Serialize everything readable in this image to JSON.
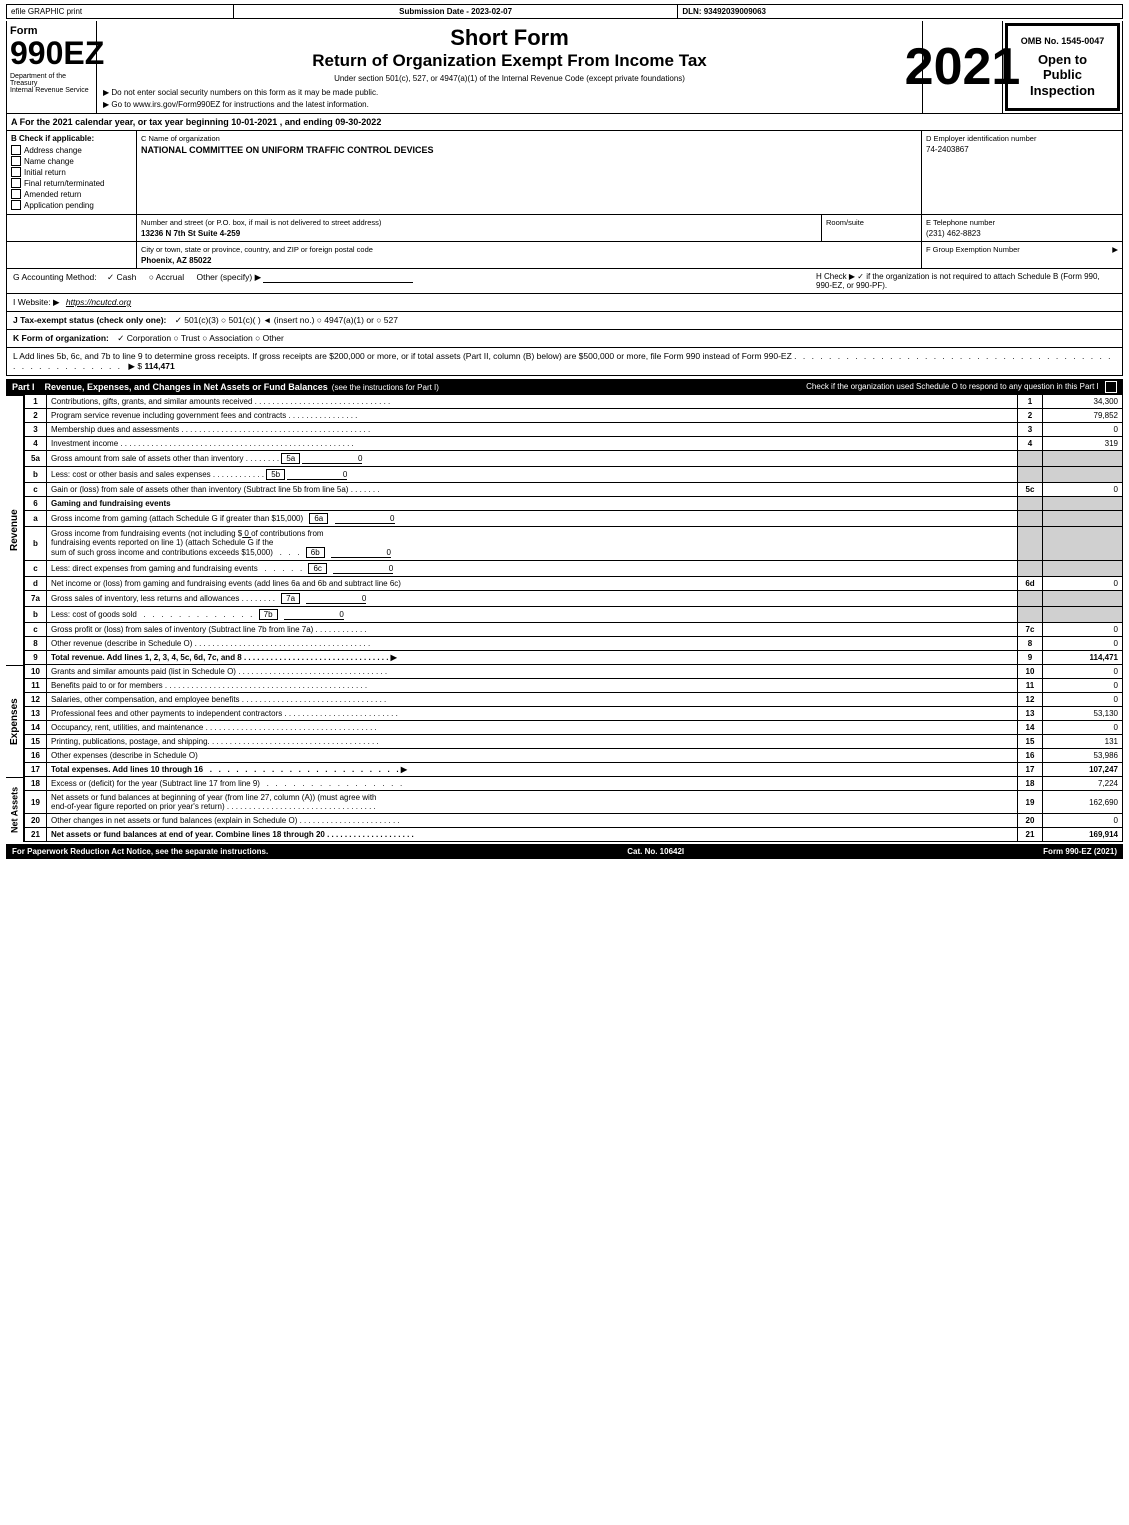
{
  "header": {
    "efile_label": "efile GRAPHIC print",
    "submission_label": "Submission Date - 2023-02-07",
    "dln_label": "DLN: 93492039009063"
  },
  "form": {
    "number": "990EZ",
    "short_form": "Short Form",
    "return_title": "Return of Organization Exempt From Income Tax",
    "subtitle": "Under section 501(c), 527, or 4947(a)(1) of the Internal Revenue Code (except private foundations)",
    "ssn_notice": "▶ Do not enter social security numbers on this form as it may be made public.",
    "goto_notice": "▶ Go to www.irs.gov/Form990EZ for instructions and the latest information.",
    "year": "2021",
    "omb": "OMB No. 1545-0047",
    "open_to_public": "Open to Public Inspection"
  },
  "dept": {
    "name": "Department of the Treasury",
    "sub": "Internal Revenue Service"
  },
  "section_a": {
    "text": "A  For the 2021 calendar year, or tax year beginning 10-01-2021 , and ending 09-30-2022"
  },
  "check_applicable": {
    "label": "B  Check if applicable:",
    "items": [
      {
        "label": "Address change",
        "checked": false
      },
      {
        "label": "Name change",
        "checked": false
      },
      {
        "label": "Initial return",
        "checked": false
      },
      {
        "label": "Final return/terminated",
        "checked": false
      },
      {
        "label": "Amended return",
        "checked": false
      },
      {
        "label": "Application pending",
        "checked": false
      }
    ]
  },
  "org": {
    "name_label": "C Name of organization",
    "name": "NATIONAL COMMITTEE ON UNIFORM TRAFFIC CONTROL DEVICES",
    "address_label": "Number and street (or P.O. box, if mail is not delivered to street address)",
    "address": "13236 N 7th St Suite 4-259",
    "room_label": "Room/suite",
    "room": "",
    "city_label": "City or town, state or province, country, and ZIP or foreign postal code",
    "city": "Phoenix, AZ  85022",
    "ein_label": "D Employer identification number",
    "ein": "74-2403867",
    "phone_label": "E Telephone number",
    "phone": "(231) 462-8823",
    "group_label": "F Group Exemption Number",
    "group_num": "▶"
  },
  "accounting": {
    "label": "G Accounting Method:",
    "cash": "✓ Cash",
    "accrual": "○ Accrual",
    "other": "Other (specify) ▶",
    "check_h": "H  Check ▶  ✓ if the organization is not required to attach Schedule B (Form 990, 990-EZ, or 990-PF)."
  },
  "website": {
    "label": "I Website: ▶",
    "url": "https://ncutcd.org"
  },
  "tax_exempt": {
    "label": "J Tax-exempt status (check only one):",
    "options": "✓ 501(c)(3)  ○ 501(c)(  )  ◄ (insert no.)  ○ 4947(a)(1) or  ○ 527"
  },
  "form_org": {
    "label": "K Form of organization:",
    "options": "✓ Corporation   ○ Trust   ○ Association   ○ Other"
  },
  "add_lines": {
    "text": "L Add lines 5b, 6c, and 7b to line 9 to determine gross receipts. If gross receipts are $200,000 or more, or if total assets (Part II, column (B) below) are $500,000 or more, file Form 990 instead of Form 990-EZ",
    "dots": ". . . . . . . . . . . . . . . . . . . . . . . . . . . . . . . . . . . . . . . . . . . . . . . . . .",
    "arrow": "▶ $",
    "value": "114,471"
  },
  "part1": {
    "label": "Part I",
    "title": "Revenue, Expenses, and Changes in Net Assets or Fund Balances",
    "subtitle": "(see the instructions for Part I)",
    "check_schedule_o": "Check if the organization used Schedule O to respond to any question in this Part I",
    "rows": [
      {
        "num": "1",
        "desc": "Contributions, gifts, grants, and similar amounts received",
        "dots": true,
        "line_col": "1",
        "value": "34,300"
      },
      {
        "num": "2",
        "desc": "Program service revenue including government fees and contracts",
        "dots": true,
        "line_col": "2",
        "value": "79,852"
      },
      {
        "num": "3",
        "desc": "Membership dues and assessments",
        "dots": true,
        "line_col": "3",
        "value": "0"
      },
      {
        "num": "4",
        "desc": "Investment income",
        "dots": true,
        "line_col": "4",
        "value": "319"
      },
      {
        "num": "5a",
        "desc": "Gross amount from sale of assets other than inventory",
        "dots": true,
        "sub_label": "5a",
        "sub_value": "0"
      },
      {
        "num": "5b",
        "desc": "Less: cost or other basis and sales expenses",
        "dots": true,
        "sub_label": "5b",
        "sub_value": "0"
      },
      {
        "num": "5c",
        "desc": "Gain or (loss) from sale of assets other than inventory (Subtract line 5b from line 5a)",
        "dots": true,
        "line_col": "5c",
        "value": "0"
      },
      {
        "num": "6",
        "desc": "Gaming and fundraising events",
        "dots": false
      },
      {
        "num": "6a",
        "desc": "Gross income from gaming (attach Schedule G if greater than $15,000)",
        "sub_label": "6a",
        "sub_value": "0",
        "dots": false
      },
      {
        "num": "6b",
        "desc": "Gross income from fundraising events (not including $ 0 of contributions from fundraising events reported on line 1) (attach Schedule G if the sum of such gross income and contributions exceeds $15,000)",
        "sub_label": "6b",
        "sub_value": "0",
        "dots": false
      },
      {
        "num": "6c",
        "desc": "Less: direct expenses from gaming and fundraising events",
        "sub_label": "6c",
        "sub_value": "0",
        "dots": false
      },
      {
        "num": "6d",
        "desc": "Net income or (loss) from gaming and fundraising events (add lines 6a and 6b and subtract line 6c)",
        "line_col": "6d",
        "value": "0",
        "dots": false
      },
      {
        "num": "7a",
        "desc": "Gross sales of inventory, less returns and allowances",
        "dots": true,
        "sub_label": "7a",
        "sub_value": "0"
      },
      {
        "num": "7b",
        "desc": "Less: cost of goods sold",
        "dots": true,
        "sub_label": "7b",
        "sub_value": "0"
      },
      {
        "num": "7c",
        "desc": "Gross profit or (loss) from sales of inventory (Subtract line 7b from line 7a)",
        "dots": true,
        "line_col": "7c",
        "value": "0"
      },
      {
        "num": "8",
        "desc": "Other revenue (describe in Schedule O)",
        "dots": true,
        "line_col": "8",
        "value": "0"
      },
      {
        "num": "9",
        "desc": "Total revenue. Add lines 1, 2, 3, 4, 5c, 6d, 7c, and 8",
        "dots": true,
        "arrow": "▶",
        "line_col": "9",
        "value": "114,471",
        "bold": true
      }
    ]
  },
  "part1_expenses": {
    "rows": [
      {
        "num": "10",
        "desc": "Grants and similar amounts paid (list in Schedule O)",
        "dots": true,
        "line_col": "10",
        "value": "0"
      },
      {
        "num": "11",
        "desc": "Benefits paid to or for members",
        "dots": true,
        "line_col": "11",
        "value": "0"
      },
      {
        "num": "12",
        "desc": "Salaries, other compensation, and employee benefits",
        "dots": true,
        "line_col": "12",
        "value": "0"
      },
      {
        "num": "13",
        "desc": "Professional fees and other payments to independent contractors",
        "dots": true,
        "line_col": "13",
        "value": "53,130"
      },
      {
        "num": "14",
        "desc": "Occupancy, rent, utilities, and maintenance",
        "dots": true,
        "line_col": "14",
        "value": "0"
      },
      {
        "num": "15",
        "desc": "Printing, publications, postage, and shipping",
        "dots": true,
        "line_col": "15",
        "value": "131"
      },
      {
        "num": "16",
        "desc": "Other expenses (describe in Schedule O)",
        "dots": false,
        "line_col": "16",
        "value": "53,986"
      },
      {
        "num": "17",
        "desc": "Total expenses. Add lines 10 through 16",
        "dots": true,
        "arrow": "▶",
        "line_col": "17",
        "value": "107,247",
        "bold": true
      }
    ]
  },
  "part1_assets": {
    "rows": [
      {
        "num": "18",
        "desc": "Excess or (deficit) for the year (Subtract line 17 from line 9)",
        "dots": true,
        "line_col": "18",
        "value": "7,224"
      },
      {
        "num": "19",
        "desc": "Net assets or fund balances at beginning of year (from line 27, column (A)) (must agree with end-of-year figure reported on prior year's return)",
        "dots": true,
        "line_col": "19",
        "value": "162,690"
      },
      {
        "num": "20",
        "desc": "Other changes in net assets or fund balances (explain in Schedule O)",
        "dots": true,
        "line_col": "20",
        "value": "0"
      },
      {
        "num": "21",
        "desc": "Net assets or fund balances at end of year. Combine lines 18 through 20",
        "dots": true,
        "line_col": "21",
        "value": "169,914",
        "bold": true
      }
    ]
  },
  "footer": {
    "paperwork": "For Paperwork Reduction Act Notice, see the separate instructions.",
    "cat_no": "Cat. No. 10642I",
    "form_label": "Form 990-EZ (2021)"
  }
}
